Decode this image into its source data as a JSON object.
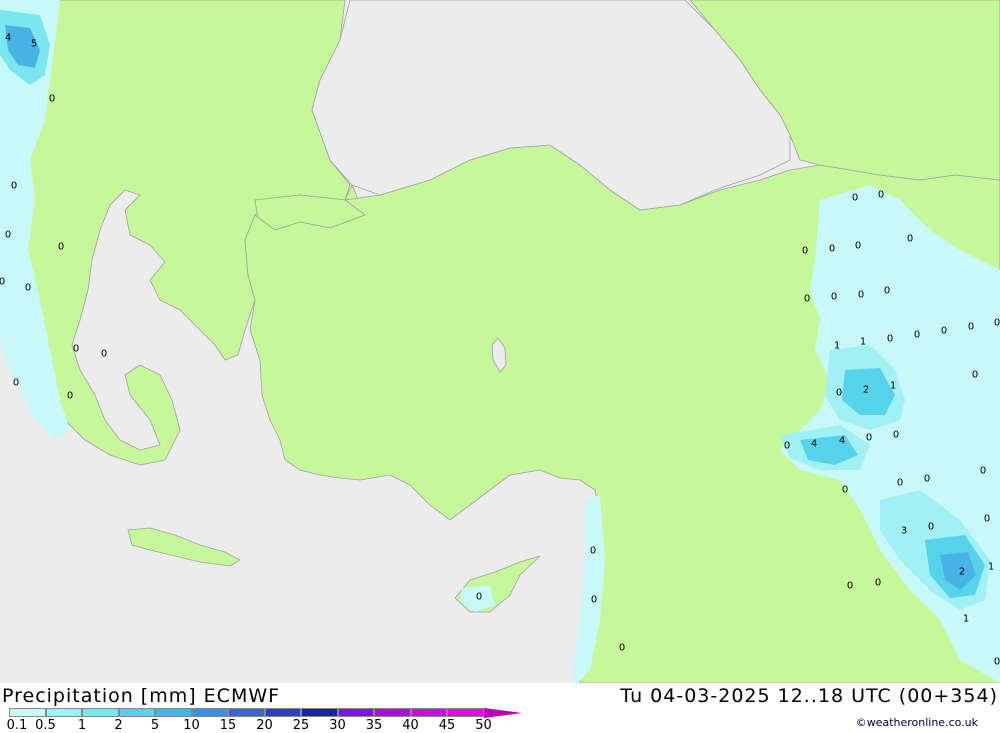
{
  "title": "Precipitation [mm] ECMWF",
  "datetime": "Tu 04-03-2025 12..18 UTC (00+354)",
  "copyright": "©weatheronline.co.uk",
  "colors": {
    "sea": "#ececec",
    "land": "#c6f79b",
    "border": "#a0a0a0"
  },
  "legend": {
    "ticks": [
      "0.1",
      "0.5",
      "1",
      "2",
      "5",
      "10",
      "15",
      "20",
      "25",
      "30",
      "35",
      "40",
      "45",
      "50"
    ],
    "colors": [
      "#c8f8f8",
      "#a0f0f4",
      "#7ce6ee",
      "#56d2ea",
      "#48b4e6",
      "#3e8ee0",
      "#3a66d6",
      "#2c3ec4",
      "#1c22a8",
      "#7a16e6",
      "#a010e8",
      "#c80ee6",
      "#e00ce2",
      "#b800b8"
    ]
  },
  "values": [
    {
      "label": "4"
    },
    {
      "label": "5"
    },
    {
      "label": "0"
    },
    {
      "label": "0"
    },
    {
      "label": "0"
    },
    {
      "label": "0"
    },
    {
      "label": "0"
    },
    {
      "label": "0"
    },
    {
      "label": "0"
    },
    {
      "label": "0"
    },
    {
      "label": "0"
    },
    {
      "label": "0"
    },
    {
      "label": "0"
    },
    {
      "label": "0"
    },
    {
      "label": "0"
    },
    {
      "label": "0"
    },
    {
      "label": "0"
    },
    {
      "label": "0"
    },
    {
      "label": "0"
    },
    {
      "label": "0"
    },
    {
      "label": "0"
    },
    {
      "label": "0"
    },
    {
      "label": "0"
    },
    {
      "label": "0"
    },
    {
      "label": "1"
    },
    {
      "label": "1"
    },
    {
      "label": "0"
    },
    {
      "label": "0"
    },
    {
      "label": "0"
    },
    {
      "label": "0"
    },
    {
      "label": "2"
    },
    {
      "label": "1"
    },
    {
      "label": "0"
    },
    {
      "label": "0"
    },
    {
      "label": "4"
    },
    {
      "label": "4"
    },
    {
      "label": "0"
    },
    {
      "label": "0"
    },
    {
      "label": "0"
    },
    {
      "label": "0"
    },
    {
      "label": "0"
    },
    {
      "label": "0"
    },
    {
      "label": "3"
    },
    {
      "label": "0"
    },
    {
      "label": "0"
    },
    {
      "label": "2"
    },
    {
      "label": "1"
    },
    {
      "label": "0"
    },
    {
      "label": "0"
    },
    {
      "label": "1"
    },
    {
      "label": "0"
    },
    {
      "label": "0"
    },
    {
      "label": "0"
    },
    {
      "label": "0"
    }
  ]
}
